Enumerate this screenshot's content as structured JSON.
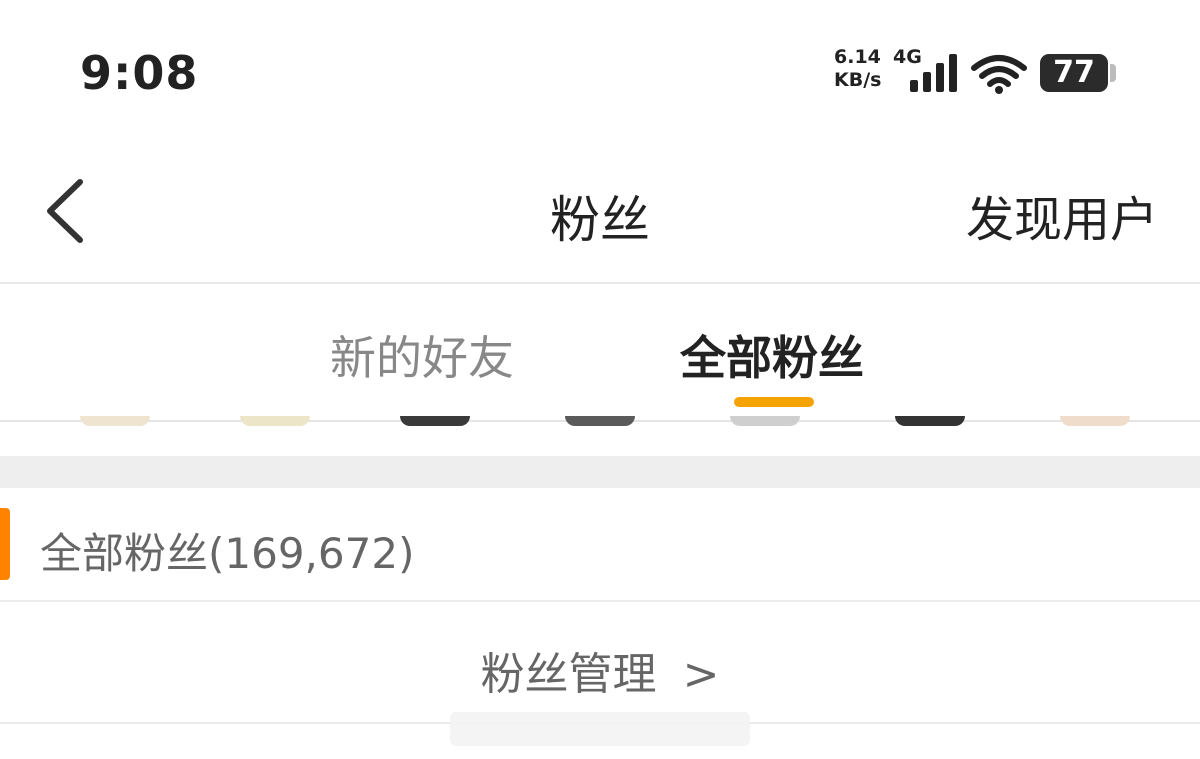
{
  "status_bar": {
    "time": "9:08",
    "net_speed_value": "6.14",
    "net_speed_unit": "KB/s",
    "network_type": "4G",
    "battery_level": "77",
    "signal_icon": "cellular-signal-icon",
    "wifi_icon": "wifi-icon"
  },
  "nav": {
    "back_icon": "chevron-left-icon",
    "title": "粉丝",
    "discover": "发现用户"
  },
  "tabs": [
    {
      "label": "新的好友",
      "active": false
    },
    {
      "label": "全部粉丝",
      "active": true
    }
  ],
  "section": {
    "label": "全部粉丝(169,672)"
  },
  "manage": {
    "label": "粉丝管理",
    "chevron": ">"
  },
  "colors": {
    "accent_orange": "#ff8200",
    "tab_indicator": "#f5a300",
    "divider_gray": "#eeeeee"
  }
}
